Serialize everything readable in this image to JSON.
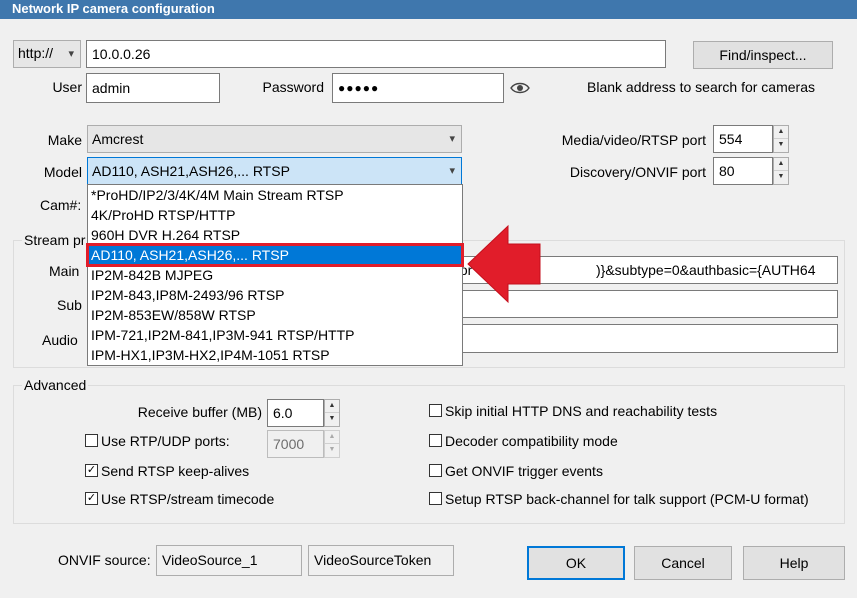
{
  "window": {
    "title": "Network IP camera configuration"
  },
  "connection": {
    "protocol": "http://",
    "address": "10.0.0.26",
    "find_button": "Find/inspect...",
    "user_label": "User",
    "user_value": "admin",
    "password_label": "Password",
    "password_value": "●●●●●",
    "hint": "Blank address to search for cameras"
  },
  "camera": {
    "make_label": "Make",
    "make_value": "Amcrest",
    "model_label": "Model",
    "model_value": "AD110, ASH21,ASH26,... RTSP",
    "cam_label": "Cam#:",
    "media_port_label": "Media/video/RTSP port",
    "media_port": "554",
    "onvif_port_label": "Discovery/ONVIF port",
    "onvif_port": "80"
  },
  "model_options": [
    "*ProHD/IP2/3/4K/4M Main Stream RTSP",
    "4K/ProHD RTSP/HTTP",
    "960H DVR H.264 RTSP",
    "AD110, ASH21,ASH26,... RTSP",
    "IP2M-842B MJPEG",
    "IP2M-843,IP8M-2493/96 RTSP",
    "IP2M-853EW/858W RTSP",
    "IPM-721,IP2M-841,IP3M-941 RTSP/HTTP",
    "IPM-HX1,IP3M-HX2,IP4M-1051 RTSP"
  ],
  "selected_option_index": 3,
  "stream": {
    "group_label": "Stream pr",
    "main_label": "Main",
    "main_value_left": "tor",
    "main_value_right": ")}&subtype=0&authbasic={AUTH64",
    "sub_label": "Sub",
    "audio_label": "Audio"
  },
  "advanced": {
    "group_label": "Advanced",
    "receive_buffer_label": "Receive buffer (MB)",
    "receive_buffer": "6.0",
    "rtp_udp_label": "Use RTP/UDP ports:",
    "rtp_udp_port": "7000",
    "keepalive_label": "Send RTSP keep-alives",
    "timecode_label": "Use RTSP/stream timecode",
    "skip_dns_label": "Skip initial HTTP DNS and reachability tests",
    "decoder_compat_label": "Decoder compatibility mode",
    "onvif_trigger_label": "Get ONVIF trigger events",
    "backchannel_label": "Setup RTSP back-channel for talk support (PCM-U format)"
  },
  "footer": {
    "onvif_source_label": "ONVIF source:",
    "video_source": "VideoSource_1",
    "video_source_token": "VideoSourceToken",
    "ok": "OK",
    "cancel": "Cancel",
    "help": "Help"
  },
  "check_glyph": "✓",
  "colors": {
    "accent": "#0078d7",
    "title_bar": "#3f77ad",
    "highlight_arrow": "#e11d2a"
  }
}
